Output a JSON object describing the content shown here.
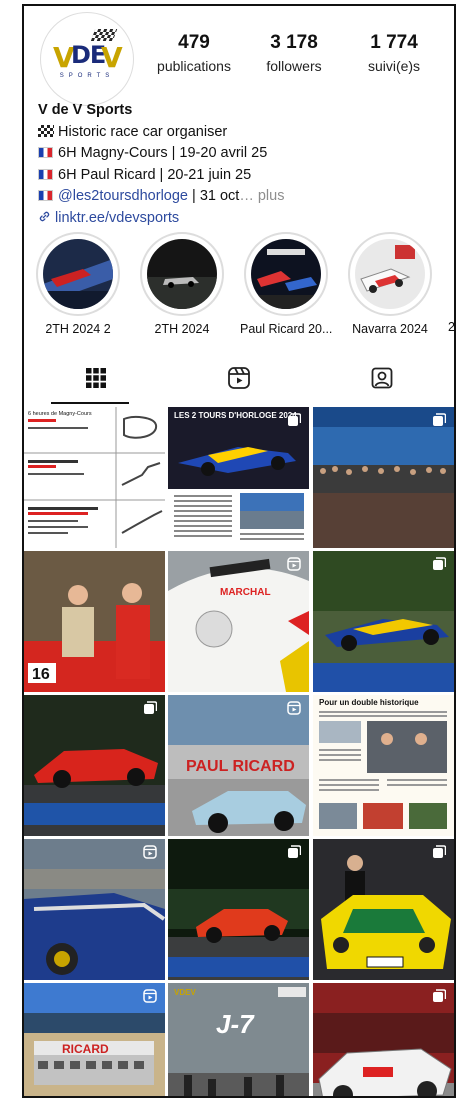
{
  "profile": {
    "logo_text": "VDEV",
    "logo_subtext": "SPORTS",
    "stats": [
      {
        "value": "479",
        "label": "publications"
      },
      {
        "value": "3 178",
        "label": "followers"
      },
      {
        "value": "1 774",
        "label": "suivi(e)s"
      }
    ],
    "name": "V de V Sports",
    "bio_line1": "Historic race car organiser",
    "bio_line2": "6H Magny-Cours | 19-20 avril 25",
    "bio_line3": "6H Paul Ricard | 20-21 juin 25",
    "bio_mention": "@les2toursdhorloge",
    "bio_line4_rest": " | 31 oct",
    "bio_more": "… plus",
    "link": "linktr.ee/vdevsports"
  },
  "highlights": [
    {
      "label": "2TH 2024 2"
    },
    {
      "label": "2TH 2024"
    },
    {
      "label": "Paul Ricard 20..."
    },
    {
      "label": "Navarra 2024"
    },
    {
      "label": "2"
    }
  ],
  "tabs": [
    {
      "icon": "grid-icon",
      "active": true
    },
    {
      "icon": "reels-icon",
      "active": false
    },
    {
      "icon": "tagged-icon",
      "active": false
    }
  ],
  "posts": [
    {
      "type": "document",
      "text": "6 heures de Magny-Cours",
      "badge": "none"
    },
    {
      "type": "magazine",
      "text": "LES 2 TOURS D'HORLOGE 2024",
      "badge": "carousel"
    },
    {
      "type": "photo",
      "badge": "carousel"
    },
    {
      "type": "photo",
      "badge": "none"
    },
    {
      "type": "photo",
      "text": "MARCHAL",
      "badge": "reel"
    },
    {
      "type": "photo",
      "badge": "carousel"
    },
    {
      "type": "photo",
      "badge": "carousel"
    },
    {
      "type": "photo",
      "text": "PAUL RICARD",
      "badge": "reel"
    },
    {
      "type": "magazine",
      "text": "Pour un double historique",
      "badge": "none"
    },
    {
      "type": "photo",
      "badge": "reel"
    },
    {
      "type": "photo",
      "badge": "carousel"
    },
    {
      "type": "photo",
      "badge": "carousel"
    },
    {
      "type": "photo",
      "text": "RICARD",
      "badge": "reel"
    },
    {
      "type": "photo",
      "text": "J-7",
      "badge": "none"
    },
    {
      "type": "photo",
      "badge": "carousel"
    }
  ],
  "colors": {
    "link": "#2d4a9e",
    "muted": "#8e8e8e",
    "logo_gold": "#c8a400",
    "logo_blue": "#1a2b7a"
  }
}
